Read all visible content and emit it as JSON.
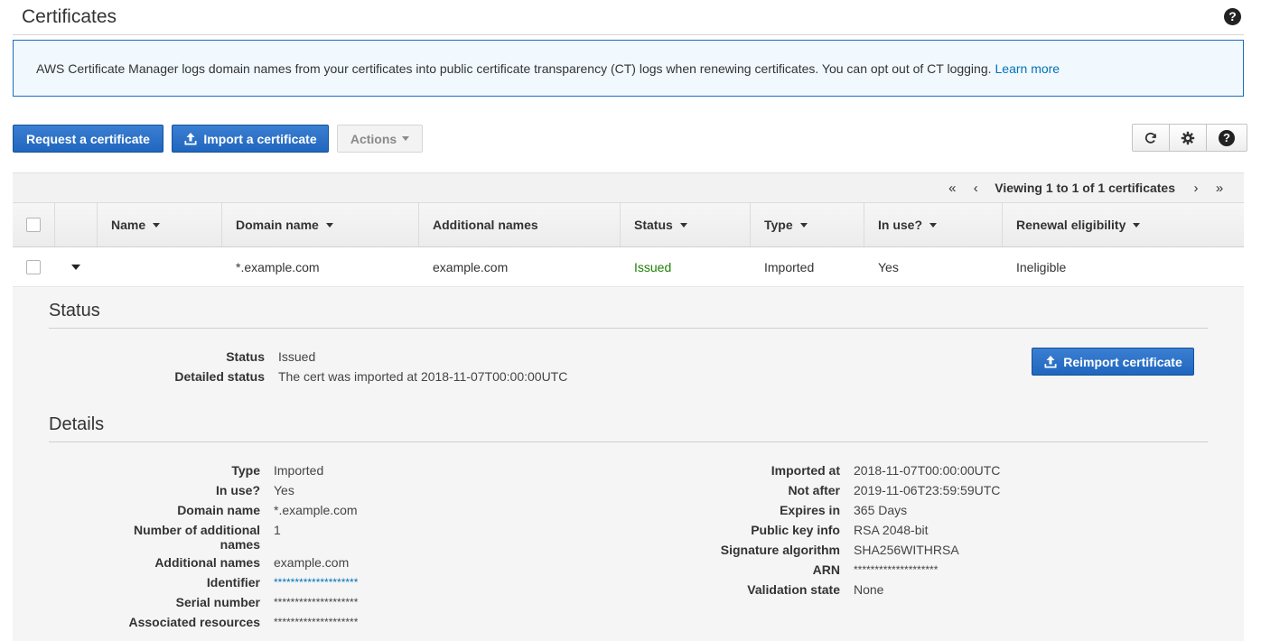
{
  "page": {
    "title": "Certificates"
  },
  "banner": {
    "text": "AWS Certificate Manager logs domain names from your certificates into public certificate transparency (CT) logs when renewing certificates. You can opt out of CT logging.",
    "link": "Learn more"
  },
  "toolbar": {
    "request_label": "Request a certificate",
    "import_label": "Import a certificate",
    "actions_label": "Actions"
  },
  "pager": {
    "text": "Viewing 1 to 1 of 1 certificates",
    "first": "«",
    "prev": "‹",
    "next": "›",
    "last": "»"
  },
  "table": {
    "columns": [
      "Name",
      "Domain name",
      "Additional names",
      "Status",
      "Type",
      "In use?",
      "Renewal eligibility"
    ],
    "rows": [
      {
        "name": "",
        "domain": "*.example.com",
        "additional": "example.com",
        "status": "Issued",
        "type": "Imported",
        "in_use": "Yes",
        "renewal": "Ineligible"
      }
    ]
  },
  "status_section": {
    "title": "Status",
    "status_label": "Status",
    "status_value": "Issued",
    "detailed_label": "Detailed status",
    "detailed_value": "The cert was imported at 2018-11-07T00:00:00UTC",
    "reimport_label": "Reimport certificate"
  },
  "details_section": {
    "title": "Details",
    "left": [
      {
        "label": "Type",
        "value": "Imported"
      },
      {
        "label": "In use?",
        "value": "Yes"
      },
      {
        "label": "Domain name",
        "value": "*.example.com"
      },
      {
        "label": "Number of additional names",
        "value": "1"
      },
      {
        "label": "Additional names",
        "value": "example.com"
      },
      {
        "label": "Identifier",
        "value": "********************"
      },
      {
        "label": "Serial number",
        "value": "********************"
      },
      {
        "label": "Associated resources",
        "value": "********************"
      }
    ],
    "right": [
      {
        "label": "Imported at",
        "value": "2018-11-07T00:00:00UTC"
      },
      {
        "label": "Not after",
        "value": "2019-11-06T23:59:59UTC"
      },
      {
        "label": "Expires in",
        "value": "365 Days"
      },
      {
        "label": "Public key info",
        "value": "RSA 2048-bit"
      },
      {
        "label": "Signature algorithm",
        "value": "SHA256WITHRSA"
      },
      {
        "label": "ARN",
        "value": "********************"
      },
      {
        "label": "Validation state",
        "value": "None"
      }
    ]
  },
  "colors": {
    "primary": "#2166bf",
    "link": "#0073bb",
    "issued": "#1d8102",
    "banner_border": "#1a6fc0",
    "banner_bg": "#f1f8fe"
  },
  "icons": {
    "help": "help-icon",
    "upload": "upload-icon",
    "refresh": "refresh-icon",
    "settings": "gear-icon"
  }
}
